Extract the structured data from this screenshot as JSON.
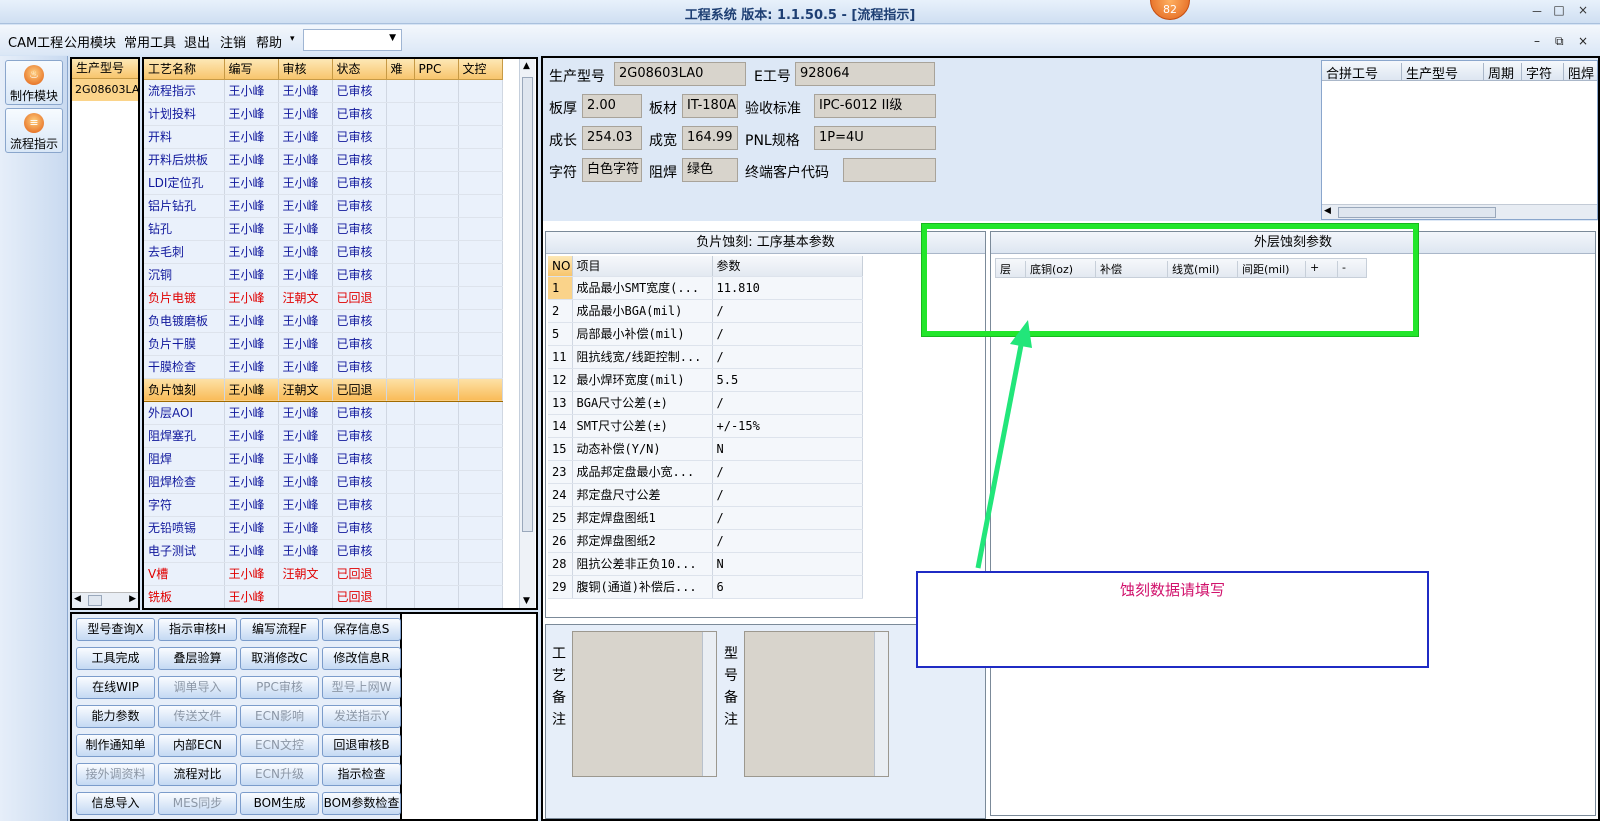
{
  "window": {
    "title": "工程系统  版本: 1.1.50.5 - [流程指示]",
    "badge": "82",
    "controls": [
      "－",
      "□",
      "×"
    ]
  },
  "menu": {
    "items": [
      "CAM工程",
      "公用模块",
      "常用工具",
      "退出",
      "注销",
      "帮助",
      "▾"
    ],
    "combo_value": "",
    "mdi_controls": [
      "–",
      "⧉",
      "×"
    ]
  },
  "sidebar": {
    "buttons": [
      {
        "label": "制作模块",
        "icon": "fire-icon"
      },
      {
        "label": "流程指示",
        "icon": "flow-icon"
      }
    ]
  },
  "model_list": {
    "header": "生产型号",
    "items": [
      "2G08603LA"
    ]
  },
  "process_table": {
    "columns": [
      "工艺名称",
      "编写",
      "审核",
      "状态",
      "难",
      "PPC",
      "文控"
    ],
    "rows": [
      [
        "流程指示",
        "王小峰",
        "王小峰",
        "已审核"
      ],
      [
        "计划投料",
        "王小峰",
        "王小峰",
        "已审核"
      ],
      [
        "开料",
        "王小峰",
        "王小峰",
        "已审核"
      ],
      [
        "开料后烘板",
        "王小峰",
        "王小峰",
        "已审核"
      ],
      [
        "LDI定位孔",
        "王小峰",
        "王小峰",
        "已审核"
      ],
      [
        "铝片钻孔",
        "王小峰",
        "王小峰",
        "已审核"
      ],
      [
        "钻孔",
        "王小峰",
        "王小峰",
        "已审核"
      ],
      [
        "去毛刺",
        "王小峰",
        "王小峰",
        "已审核"
      ],
      [
        "沉铜",
        "王小峰",
        "王小峰",
        "已审核"
      ],
      [
        "负片电镀",
        "王小峰",
        "汪朝文",
        "已回退"
      ],
      [
        "负电镀磨板",
        "王小峰",
        "王小峰",
        "已审核"
      ],
      [
        "负片干膜",
        "王小峰",
        "王小峰",
        "已审核"
      ],
      [
        "干膜检查",
        "王小峰",
        "王小峰",
        "已审核"
      ],
      [
        "负片蚀刻",
        "王小峰",
        "汪朝文",
        "已回退"
      ],
      [
        "外层AOI",
        "王小峰",
        "王小峰",
        "已审核"
      ],
      [
        "阻焊塞孔",
        "王小峰",
        "王小峰",
        "已审核"
      ],
      [
        "阻焊",
        "王小峰",
        "王小峰",
        "已审核"
      ],
      [
        "阻焊检查",
        "王小峰",
        "王小峰",
        "已审核"
      ],
      [
        "字符",
        "王小峰",
        "王小峰",
        "已审核"
      ],
      [
        "无铅喷锡",
        "王小峰",
        "王小峰",
        "已审核"
      ],
      [
        "电子测试",
        "王小峰",
        "王小峰",
        "已审核"
      ],
      [
        "V槽",
        "王小峰",
        "汪朝文",
        "已回退"
      ],
      [
        "铣板",
        "王小峰",
        "",
        "已回退"
      ]
    ],
    "selected_index": 13,
    "red_rows": [
      9,
      21,
      22
    ]
  },
  "function_buttons": [
    {
      "label": "型号查询X",
      "enabled": true
    },
    {
      "label": "指示审核H",
      "enabled": true
    },
    {
      "label": "编写流程F",
      "enabled": true
    },
    {
      "label": "保存信息S",
      "enabled": true
    },
    {
      "label": "工具完成",
      "enabled": true
    },
    {
      "label": "叠层验算",
      "enabled": true
    },
    {
      "label": "取消修改C",
      "enabled": true
    },
    {
      "label": "修改信息R",
      "enabled": true
    },
    {
      "label": "在线WIP",
      "enabled": true
    },
    {
      "label": "调单导入",
      "enabled": false
    },
    {
      "label": "PPC审核",
      "enabled": false
    },
    {
      "label": "型号上网W",
      "enabled": false
    },
    {
      "label": "能力参数",
      "enabled": true
    },
    {
      "label": "传送文件",
      "enabled": false
    },
    {
      "label": "ECN影响",
      "enabled": false
    },
    {
      "label": "发送指示Y",
      "enabled": false
    },
    {
      "label": "制作通知单",
      "enabled": true
    },
    {
      "label": "内部ECN",
      "enabled": true
    },
    {
      "label": "ECN文控",
      "enabled": false
    },
    {
      "label": "回退审核B",
      "enabled": true
    },
    {
      "label": "接外调资料",
      "enabled": false
    },
    {
      "label": "流程对比",
      "enabled": true
    },
    {
      "label": "ECN升级",
      "enabled": false
    },
    {
      "label": "指示检查",
      "enabled": true
    },
    {
      "label": "信息导入",
      "enabled": true
    },
    {
      "label": "MES同步",
      "enabled": false
    },
    {
      "label": "BOM生成",
      "enabled": true
    },
    {
      "label": "BOM参数检查",
      "enabled": true
    }
  ],
  "info": {
    "model_label": "生产型号",
    "model_value": "2G08603LA0",
    "e_no_label": "E工号",
    "e_no_value": "928064",
    "thickness_label": "板厚",
    "thickness_value": "2.00",
    "material_label": "板材",
    "material_value": "IT-180A",
    "standard_label": "验收标准",
    "standard_value": "IPC-6012 II级",
    "length_label": "成长",
    "length_value": "254.03",
    "width_label": "成宽",
    "width_value": "164.99",
    "pnl_label": "PNL规格",
    "pnl_value": "1P=4U",
    "char_label": "字符",
    "char_value": "白色字符",
    "mask_label": "阻焊",
    "mask_value": "绿色",
    "customer_label": "终端客户代码",
    "customer_value": ""
  },
  "combo_table": {
    "columns": [
      "合拼工号",
      "生产型号",
      "周期",
      "字符",
      "阻焊"
    ]
  },
  "basic_params": {
    "title": "负片蚀刻: 工序基本参数",
    "columns": [
      "NO",
      "项目",
      "参数"
    ],
    "rows": [
      [
        "1",
        "成品最小SMT宽度(...",
        "11.810"
      ],
      [
        "2",
        "成品最小BGA(mil)",
        "/"
      ],
      [
        "5",
        "局部最小补偿(mil)",
        "/"
      ],
      [
        "11",
        "阻抗线宽/线距控制...",
        "/"
      ],
      [
        "12",
        "最小焊环宽度(mil)",
        "5.5"
      ],
      [
        "13",
        "BGA尺寸公差(±)",
        "/"
      ],
      [
        "14",
        "SMT尺寸公差(±)",
        "+/-15%"
      ],
      [
        "15",
        "动态补偿(Y/N)",
        "N"
      ],
      [
        "23",
        "成品邦定盘最小宽...",
        "/"
      ],
      [
        "24",
        "邦定盘尺寸公差",
        "/"
      ],
      [
        "25",
        "邦定焊盘图纸1",
        "/"
      ],
      [
        "26",
        "邦定焊盘图纸2",
        "/"
      ],
      [
        "28",
        "阻抗公差非正负10...",
        "N"
      ],
      [
        "29",
        "腹铜(通道)补偿后...",
        "6"
      ]
    ]
  },
  "notes": {
    "process_label": "工艺备注",
    "model_label": "型号备注"
  },
  "etch_params": {
    "title": "外层蚀刻参数",
    "columns": [
      "层",
      "底铜(oz)",
      "补偿",
      "线宽(mil)",
      "间距(mil)",
      "+",
      "-"
    ]
  },
  "annotation": {
    "text": "蚀刻数据请填写"
  },
  "colors": {
    "highlight": "#f9bb58",
    "approved_text": "#10189c",
    "rejected_text": "#e00000",
    "callout_green": "#22e62b",
    "callout_blue": "#1f2bc4",
    "callout_text": "#d1126c"
  }
}
